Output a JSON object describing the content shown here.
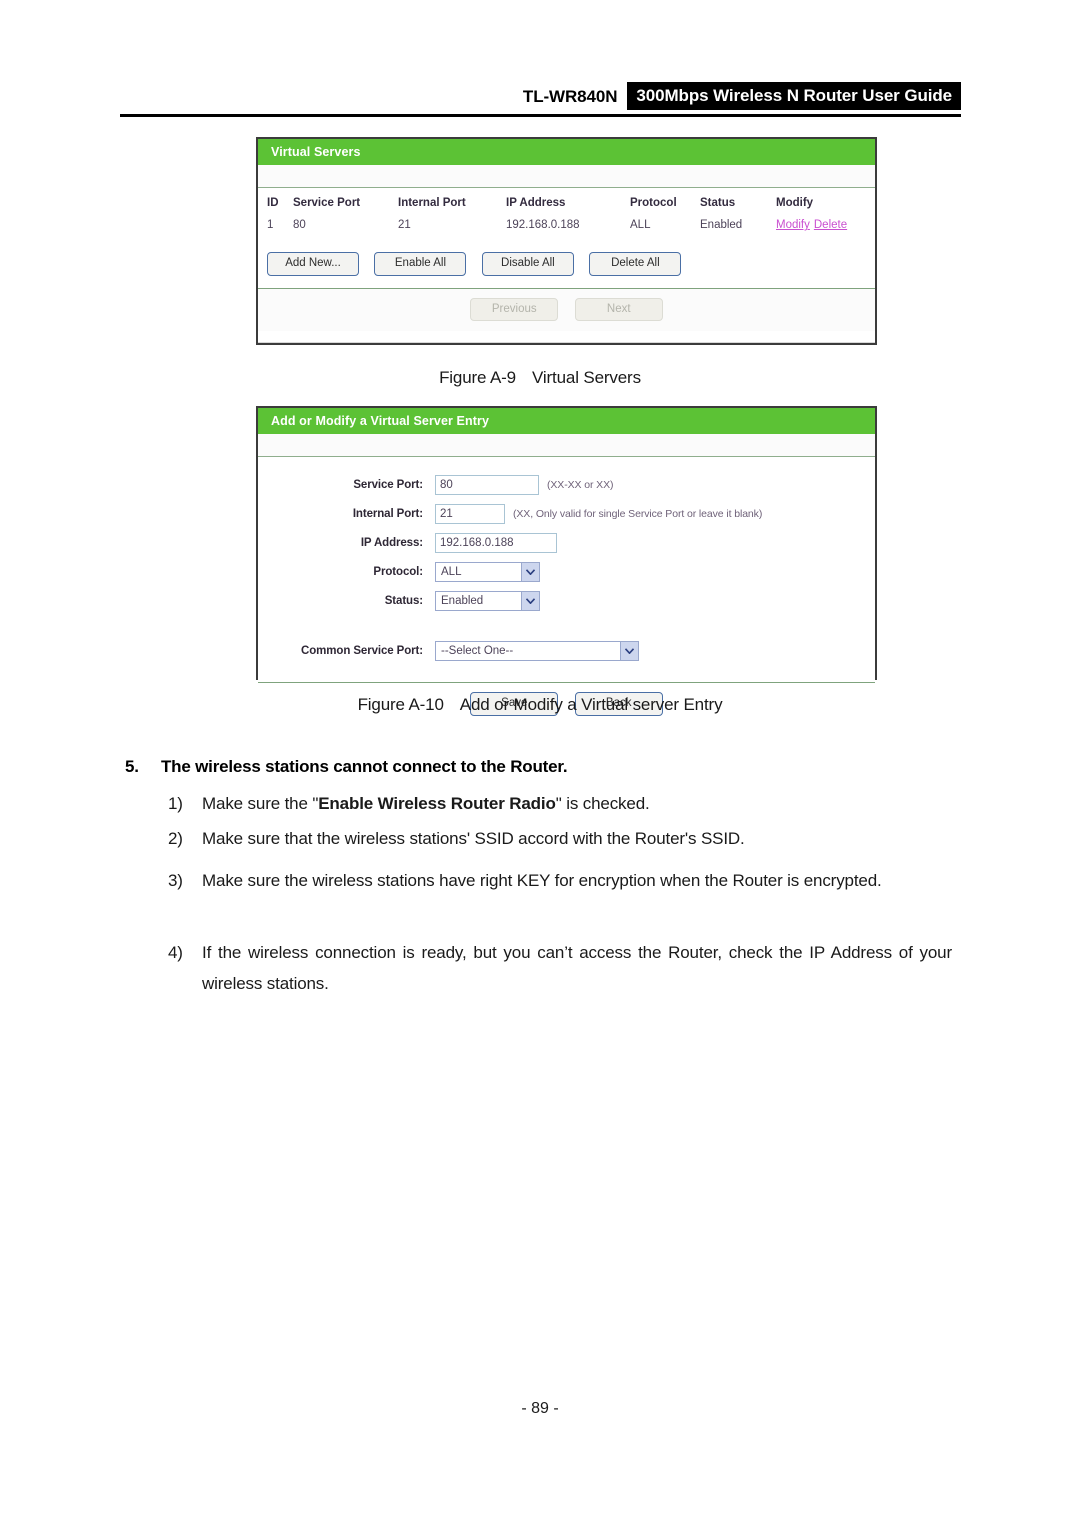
{
  "header": {
    "model": "TL-WR840N",
    "title": "300Mbps Wireless N Router User Guide"
  },
  "virtual_servers_panel": {
    "title": "Virtual Servers",
    "columns": [
      "ID",
      "Service Port",
      "Internal Port",
      "IP Address",
      "Protocol",
      "Status",
      "Modify"
    ],
    "rows": [
      {
        "id": "1",
        "service_port": "80",
        "internal_port": "21",
        "ip_address": "192.168.0.188",
        "protocol": "ALL",
        "status": "Enabled",
        "modify_link": "Modify",
        "delete_link": "Delete"
      }
    ],
    "buttons": {
      "add_new": "Add New...",
      "enable_all": "Enable All",
      "disable_all": "Disable All",
      "delete_all": "Delete All"
    },
    "pager": {
      "previous": "Previous",
      "next": "Next"
    }
  },
  "figure_a9": {
    "number": "Figure A-9",
    "caption": "Virtual Servers"
  },
  "entry_panel": {
    "title": "Add or Modify a Virtual Server Entry",
    "fields": {
      "service_port": {
        "label": "Service Port:",
        "value": "80",
        "hint": "(XX-XX or XX)"
      },
      "internal_port": {
        "label": "Internal Port:",
        "value": "21",
        "hint": "(XX, Only valid for single Service Port or leave it blank)"
      },
      "ip_address": {
        "label": "IP Address:",
        "value": "192.168.0.188"
      },
      "protocol": {
        "label": "Protocol:",
        "value": "ALL"
      },
      "status": {
        "label": "Status:",
        "value": "Enabled"
      },
      "common_service_port": {
        "label": "Common Service Port:",
        "value": "--Select One--"
      }
    },
    "buttons": {
      "save": "Save",
      "back": "Back"
    }
  },
  "figure_a10": {
    "number": "Figure A-10",
    "caption": "Add or Modify a Virtual server Entry"
  },
  "section": {
    "number": "5.",
    "heading": "The wireless stations cannot connect to the Router.",
    "items": [
      {
        "marker": "1)",
        "text_before": "Make sure the \"",
        "text_bold": "Enable Wireless Router Radio",
        "text_after": "\" is checked."
      },
      {
        "marker": "2)",
        "text": "Make sure that the wireless stations' SSID accord with the Router's SSID."
      },
      {
        "marker": "3)",
        "text": "Make sure the wireless stations have right KEY for encryption when the Router is encrypted."
      },
      {
        "marker": "4)",
        "text": "If the wireless connection is ready, but you can’t access the Router, check the IP Address of your wireless stations."
      }
    ]
  },
  "footer": {
    "page_number": "- 89 -"
  },
  "colors": {
    "panel_header_green": "#5cc235",
    "link_magenta": "#c94fd0",
    "button_border_blue": "#4a6fa5",
    "table_text": "#4d4359"
  }
}
